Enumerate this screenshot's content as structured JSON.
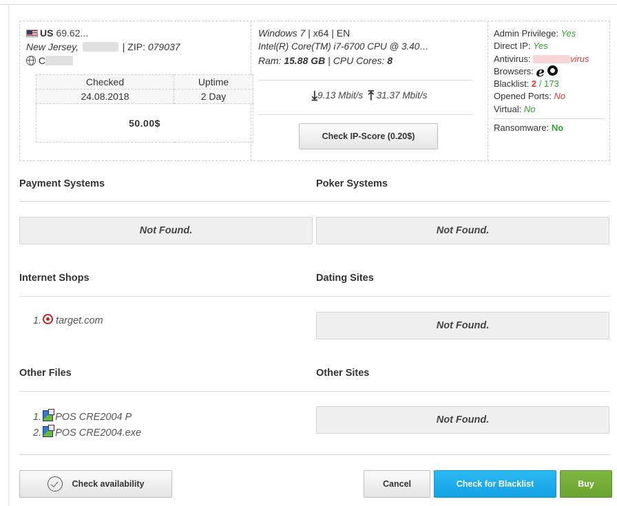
{
  "header": {
    "country_code": "US",
    "ip_partial": "69.62...",
    "state": "New Jersey,",
    "zip_label": "| ZIP:",
    "zip_value": "079037",
    "city_initial": "C"
  },
  "stats": {
    "checked_label": "Checked",
    "uptime_label": "Uptime",
    "checked_value": "24.08.2018",
    "uptime_value": "2 Day",
    "price": "50.00$"
  },
  "system": {
    "os_line_italic": "Windows 7",
    "os_line_rest": "| x64 | EN",
    "cpu": "Intel(R) Core(TM) i7-6700 CPU @ 3.40…",
    "ram_label": "Ram:",
    "ram_value": "15.88 GB",
    "cores_label": "| CPU Cores:",
    "cores_value": "8",
    "download": "9.13 Mbit/s",
    "upload": "31.37 Mbit/s",
    "ipscore_button": "Check IP-Score (0.20$)"
  },
  "security": {
    "admin_label": "Admin Privilege:",
    "admin_value": "Yes",
    "direct_ip_label": "Direct IP:",
    "direct_ip_value": "Yes",
    "antivirus_label": "Antivirus:",
    "antivirus_value": "virus",
    "browsers_label": "Browsers:",
    "blacklist_label": "Blacklist:",
    "blacklist_hits": "2",
    "blacklist_sep": " / ",
    "blacklist_total": "173",
    "ports_label": "Opened Ports:",
    "ports_value": "No",
    "virtual_label": "Virtual:",
    "virtual_value": "No",
    "ransomware_label": "Ransomware:",
    "ransomware_value": "No"
  },
  "sections": {
    "payment_title": "Payment Systems",
    "payment_value": "Not Found.",
    "poker_title": "Poker Systems",
    "poker_value": "Not Found.",
    "shops_title": "Internet Shops",
    "shops_items": [
      "1.",
      "target.com"
    ],
    "dating_title": "Dating Sites",
    "dating_value": "Not Found.",
    "files_title": "Other Files",
    "files_items": [
      {
        "num": "1.",
        "name": "POS CRE2004 P"
      },
      {
        "num": "2.",
        "name": "POS CRE2004.exe"
      }
    ],
    "sites_title": "Other Sites",
    "sites_value": "Not Found."
  },
  "actions": {
    "check_availability": "Check availability",
    "cancel": "Cancel",
    "check_blacklist": "Check for Blacklist",
    "buy": "Buy"
  },
  "colors": {
    "price_green": "#8cc63f",
    "status_green": "#2ea42e",
    "status_red": "#e03b3b",
    "blue_button": "#12a1e4",
    "green_button": "#6aa32f"
  }
}
